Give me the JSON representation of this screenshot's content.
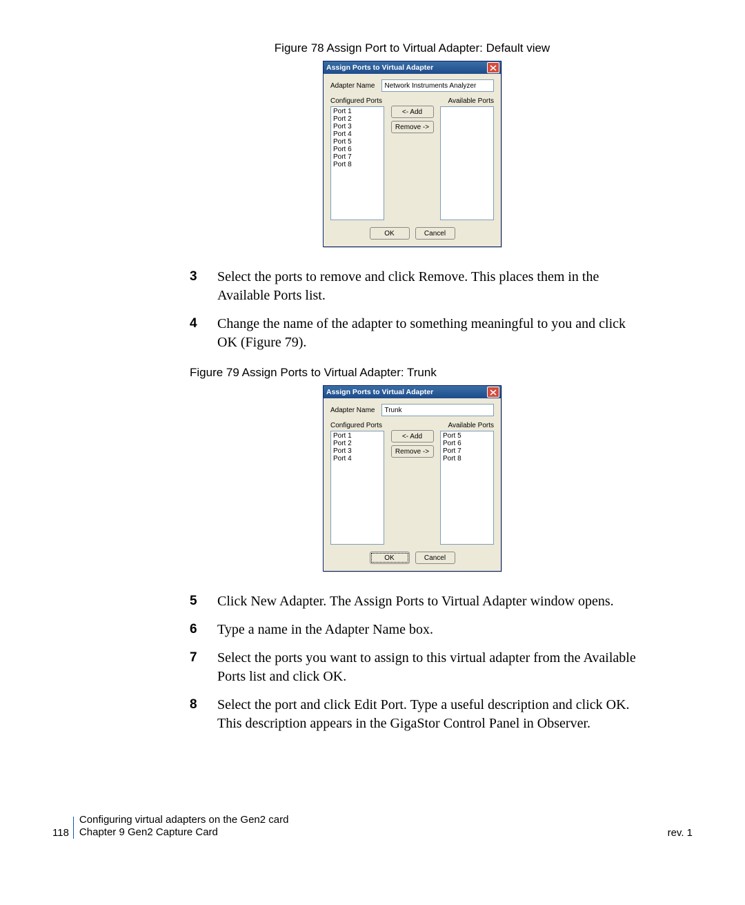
{
  "figure1": {
    "caption": "Figure 78  Assign Port to Virtual Adapter: Default view",
    "dialog": {
      "title": "Assign Ports to Virtual Adapter",
      "adapter_label": "Adapter Name",
      "adapter_value": "Network Instruments Analyzer",
      "configured_label": "Configured Ports",
      "available_label": "Available Ports",
      "configured_ports": [
        "Port  1",
        "Port  2",
        "Port  3",
        "Port  4",
        "Port  5",
        "Port  6",
        "Port  7",
        "Port  8"
      ],
      "available_ports": [],
      "add_btn": "<- Add",
      "remove_btn": "Remove ->",
      "ok_btn": "OK",
      "cancel_btn": "Cancel"
    }
  },
  "figure2": {
    "caption": "Figure 79  Assign Ports to Virtual Adapter: Trunk",
    "dialog": {
      "title": "Assign Ports to Virtual Adapter",
      "adapter_label": "Adapter Name",
      "adapter_value": "Trunk",
      "configured_label": "Configured Ports",
      "available_label": "Available Ports",
      "configured_ports": [
        "Port  1",
        "Port  2",
        "Port  3",
        "Port  4"
      ],
      "available_ports": [
        "Port  5",
        "Port  6",
        "Port  7",
        "Port  8"
      ],
      "add_btn": "<- Add",
      "remove_btn": "Remove ->",
      "ok_btn": "OK",
      "cancel_btn": "Cancel"
    }
  },
  "steps": {
    "s3": {
      "num": "3",
      "text": "Select the ports to remove and click Remove. This places them in the Available Ports list."
    },
    "s4": {
      "num": "4",
      "text": "Change the name of the adapter to something meaningful to you and click OK (Figure 79)."
    },
    "s5": {
      "num": "5",
      "text": "Click New Adapter. The Assign Ports to Virtual Adapter window opens."
    },
    "s6": {
      "num": "6",
      "text": "Type a name in the Adapter Name box."
    },
    "s7": {
      "num": "7",
      "text": "Select the ports you want to assign to this virtual adapter from the Available Ports list and click OK."
    },
    "s8": {
      "num": "8",
      "text": "Select the port and click Edit Port. Type a useful description and click OK. This description appears in the GigaStor Control Panel in Observer."
    }
  },
  "footer": {
    "pagenum": "118",
    "line1": "Configuring virtual adapters on the Gen2 card",
    "line2": "Chapter 9 Gen2 Capture Card",
    "rev": "rev. 1"
  }
}
